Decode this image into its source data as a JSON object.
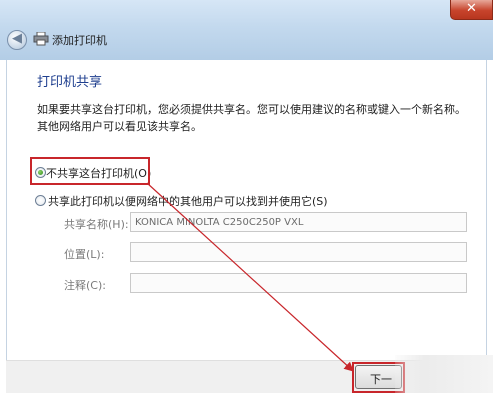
{
  "window": {
    "title": "添加打印机",
    "close_glyph": "✕",
    "back_glyph": "◀",
    "back_icon": "back-arrow-icon",
    "printer_icon": "printer-icon"
  },
  "page": {
    "heading": "打印机共享",
    "description": "如果要共享这台打印机，您必须提供共享名。您可以使用建议的名称或键入一个新名称。其他网络用户可以看见该共享名。"
  },
  "options": {
    "no_share": {
      "label": "不共享这台打印机(O)",
      "selected": true
    },
    "share": {
      "label": "共享此打印机以便网络中的其他用户可以找到并使用它(S)",
      "selected": false
    }
  },
  "fields": {
    "share_name": {
      "label": "共享名称(H):",
      "value": "KONICA MINOLTA C250C250P VXL"
    },
    "location": {
      "label": "位置(L):",
      "value": ""
    },
    "comment": {
      "label": "注释(C):",
      "value": ""
    }
  },
  "footer": {
    "next_label": "下一"
  },
  "colors": {
    "highlight": "#c8262b",
    "heading": "#1f3f8f",
    "titlebar": "#c3d9ee"
  }
}
